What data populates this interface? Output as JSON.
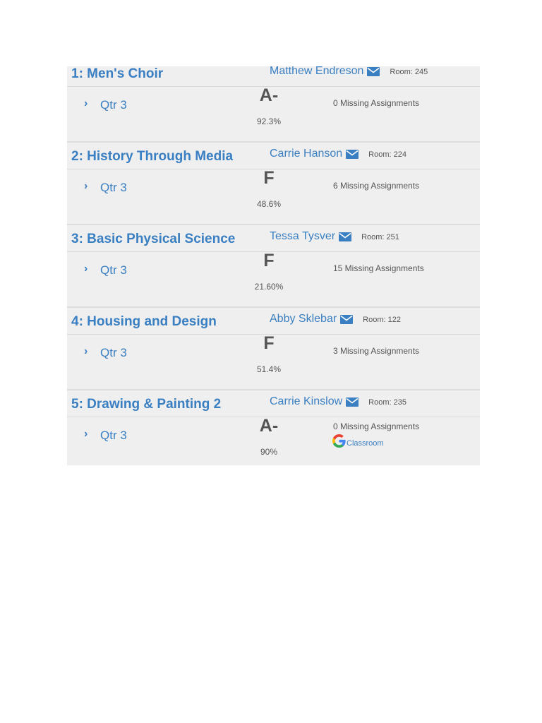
{
  "courses": [
    {
      "title": "1: Men's Choir",
      "teacher": "Matthew Endreson",
      "room": "Room: 245",
      "term": "Qtr 3",
      "grade": "A-",
      "percent": "92.3%",
      "missing": "0 Missing Assignments"
    },
    {
      "title": "2: History Through Media",
      "teacher": "Carrie Hanson",
      "room": "Room: 224",
      "term": "Qtr 3",
      "grade": "F",
      "percent": "48.6%",
      "missing": "6 Missing Assignments"
    },
    {
      "title": "3: Basic Physical Science",
      "teacher": "Tessa Tysver",
      "room": "Room: 251",
      "term": "Qtr 3",
      "grade": "F",
      "percent": "21.60%",
      "missing": "15 Missing Assignments"
    },
    {
      "title": "4: Housing and Design",
      "teacher": "Abby Sklebar",
      "room": "Room: 122",
      "term": "Qtr 3",
      "grade": "F",
      "percent": "51.4%",
      "missing": "3 Missing Assignments"
    },
    {
      "title": "5: Drawing & Painting 2",
      "teacher": "Carrie Kinslow",
      "room": "Room: 235",
      "term": "Qtr 3",
      "grade": "A-",
      "percent": "90%",
      "missing": "0 Missing Assignments",
      "google_classroom_label": "Classroom"
    }
  ],
  "colors": {
    "link": "#3a7fc2",
    "text": "#555555",
    "panel_bg": "#efefef"
  },
  "icons": {
    "email": "envelope-icon",
    "expand": "chevron-right-icon",
    "google": "google-g-icon"
  }
}
